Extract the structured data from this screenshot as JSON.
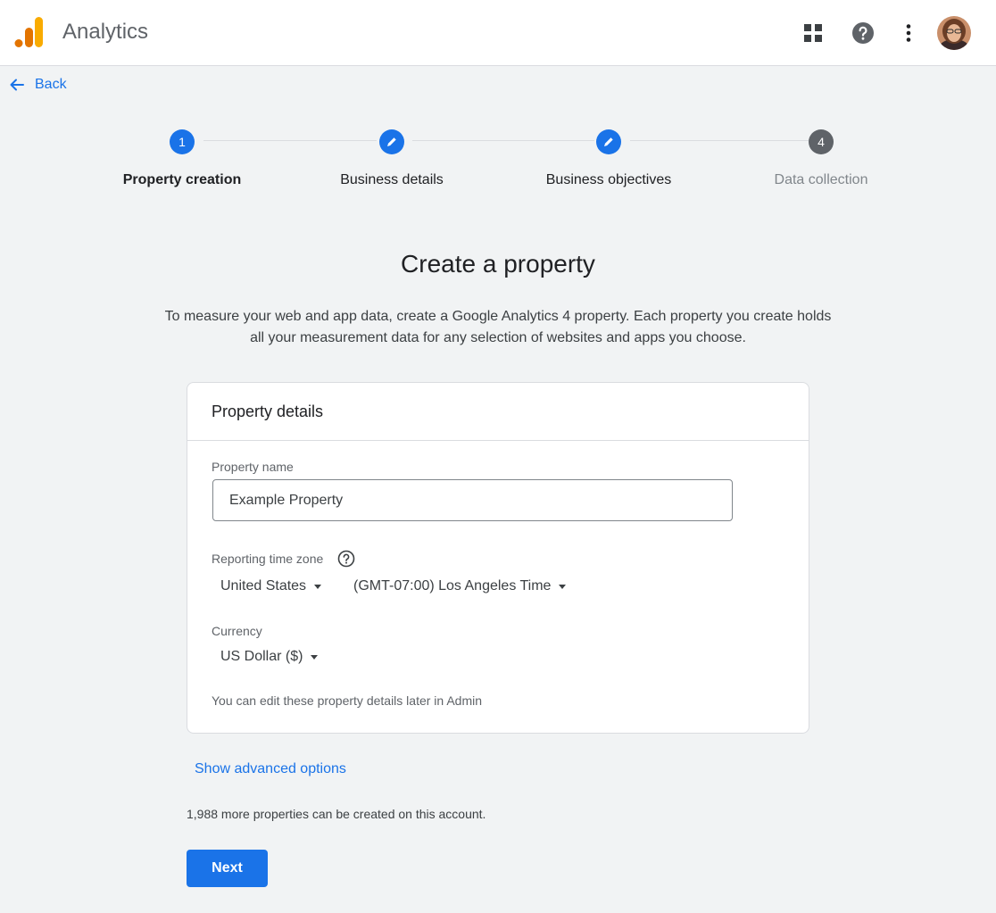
{
  "header": {
    "app_title": "Analytics",
    "icons": [
      "apps-grid-icon",
      "help-icon",
      "more-vert-icon",
      "avatar"
    ]
  },
  "nav": {
    "back_label": "Back"
  },
  "stepper": {
    "steps": [
      {
        "number": "1",
        "label": "Property creation",
        "state": "current"
      },
      {
        "number": "",
        "label": "Business details",
        "state": "edit"
      },
      {
        "number": "",
        "label": "Business objectives",
        "state": "edit"
      },
      {
        "number": "4",
        "label": "Data collection",
        "state": "upcoming"
      }
    ]
  },
  "main": {
    "title": "Create a property",
    "intro_line1": "To measure your web and app data, create a Google Analytics 4 property. Each property you create holds",
    "intro_line2": "all your measurement data for any selection of websites and apps you choose."
  },
  "card": {
    "header": "Property details",
    "property_name_label": "Property name",
    "property_name_value": "Example Property",
    "timezone_label": "Reporting time zone",
    "country_value": "United States",
    "timezone_value": "(GMT-07:00) Los Angeles Time",
    "currency_label": "Currency",
    "currency_value": "US Dollar ($)",
    "note": "You can edit these property details later in Admin"
  },
  "footer": {
    "advanced_link": "Show advanced options",
    "quota_text": "1,988 more properties can be created on this account.",
    "next_label": "Next"
  },
  "colors": {
    "accent": "#1a73e8",
    "background": "#f1f3f4",
    "logo_orange": "#f9ab00",
    "logo_dark_orange": "#e37400"
  }
}
